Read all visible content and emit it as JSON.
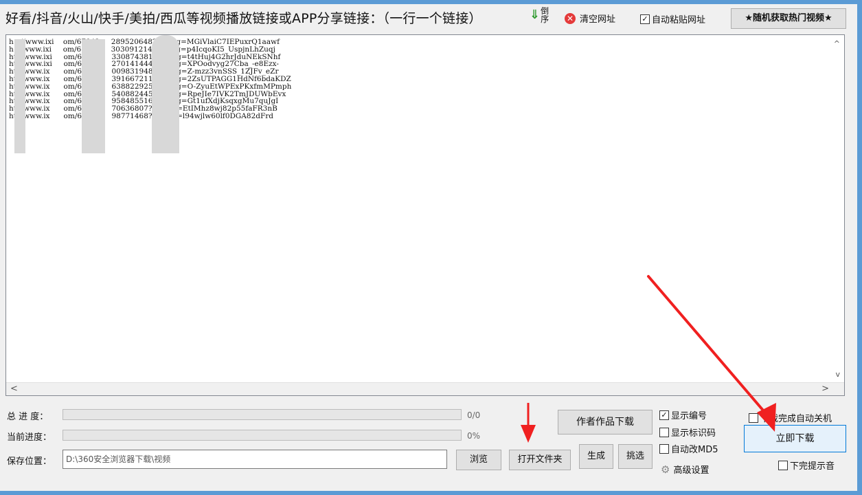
{
  "header": {
    "title": "好看/抖音/火山/快手/美拍/西瓜等视频播放链接或APP分享链接：（一行一个链接）",
    "sort_label": "倒序",
    "clear_label": "清空网址",
    "auto_paste_label": "自动粘贴网址",
    "auto_paste_checked": true,
    "hot_button_label": "★随机获取热门视频★"
  },
  "links": [
    "h   //www.ixi    om/67842     289520648?logTag=MGiVlaiC7IEPuxrQ1aawf",
    "h   /www.ixi     om/68002     303091214?logTag=p4IcqoKI5_UspjnLhZuqj",
    "ht  /www.ixi     om/68803     330874381?logTag=t4tHuj4G2hrJduNEkSNhf",
    "ht  /www.ixi     om/68459     270141444?logTag=XPOodvyg27Cba_-e8Ezx-",
    "ht  /www.ix      om/68125     009831948?logTag=Z-mzz3vnSSS_1ZJFv_eZr",
    "ht  /www.ix      om/67788     391667211?logTag=2ZsUTPAGG1HdNf6bdaKDZ",
    "ht  /www.ix      om/67874     638822925?logTag=O-ZyuEtWPExPKxfmMPmph",
    "ht  /www.ix      om/67974     540882445?logTag=RpeJIe7IVK2TmJDUWbEvx",
    "ht  /www.ix      om/68287     958485516?logTag=Gt1ufXdjKsqxgMu7quJgI",
    "ht  /www.ix      om/68581     70636807?logTag=EtIMhz8wj82p55faFR3nB",
    "ht  /www.ix      om/68381     98771468?logTag=l94wjlw60lf0DGA82dFrd"
  ],
  "progress": {
    "total_label": "总 进 度：",
    "total_value": "0/0",
    "current_label": "当前进度：",
    "current_value": "0%"
  },
  "save": {
    "label": "保存位置：",
    "path": "D:\\360安全浏览器下载\\视频",
    "browse_label": "浏览",
    "open_folder_label": "打开文件夹"
  },
  "actions": {
    "author_download_label": "作者作品下载",
    "generate_label": "生成",
    "pick_label": "挑选",
    "download_now_label": "立即下载"
  },
  "options": {
    "show_number": "显示编号",
    "show_number_checked": true,
    "show_id_code": "显示标识码",
    "auto_md5": "自动改MD5",
    "advanced": "高级设置",
    "auto_shutdown": "下载完成自动关机",
    "finish_sound": "下完提示音"
  }
}
